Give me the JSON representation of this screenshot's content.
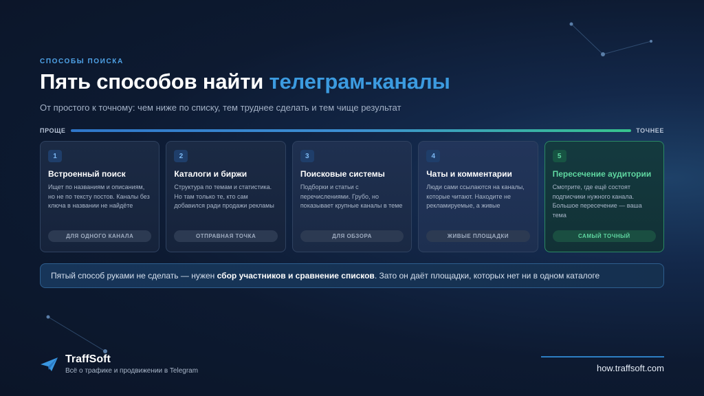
{
  "eyebrow": "СПОСОБЫ ПОИСКА",
  "title": {
    "main": "Пять способов найти ",
    "accent": "телеграм-каналы"
  },
  "subtitle": "От простого к точному: чем ниже по списку, тем труднее сделать и тем чище результат",
  "scale": {
    "left_label": "ПРОЩЕ",
    "right_label": "ТОЧНЕЕ"
  },
  "cards": [
    {
      "number": "1",
      "title": "Встроенный поиск",
      "text": "Ищет по названиям и описаниям, но не по тексту постов. Каналы без ключа в названии не найдёте",
      "tag": "ДЛЯ ОДНОГО КАНАЛА"
    },
    {
      "number": "2",
      "title": "Каталоги и биржи",
      "text": "Структура по темам и статистика. Но там только те, кто сам добавился ради продажи рекламы",
      "tag": "ОТПРАВНАЯ ТОЧКА"
    },
    {
      "number": "3",
      "title": "Поисковые системы",
      "text": "Подборки и статьи с перечислениями. Грубо, но показывает крупные каналы в теме",
      "tag": "ДЛЯ ОБЗОРА"
    },
    {
      "number": "4",
      "title": "Чаты и комментарии",
      "text": "Люди сами ссылаются на каналы, которые читают. Находите не рекламируемые, а живые",
      "tag": "ЖИВЫЕ ПЛОЩАДКИ"
    },
    {
      "number": "5",
      "title": "Пересечение аудитории",
      "text": "Смотрите, где ещё состоят подписчики нужного канала. Большое пересечение — ваша тема",
      "tag": "САМЫЙ ТОЧНЫЙ"
    }
  ],
  "callout": {
    "before": "Пятый способ руками не сделать — нужен ",
    "bold": "сбор участников и сравнение списков",
    "after": ". Зато он даёт площадки, которых нет ни в одном каталоге"
  },
  "brand": {
    "name": "TraffSoft",
    "tagline": "Всё о трафике и продвижении в Telegram",
    "logo_icon": "paper-plane-icon"
  },
  "footer_url": "how.traffsoft.com",
  "colors": {
    "accent_blue": "#3c9be0",
    "accent_green": "#5fd6a0",
    "background": "#0d1a31"
  }
}
